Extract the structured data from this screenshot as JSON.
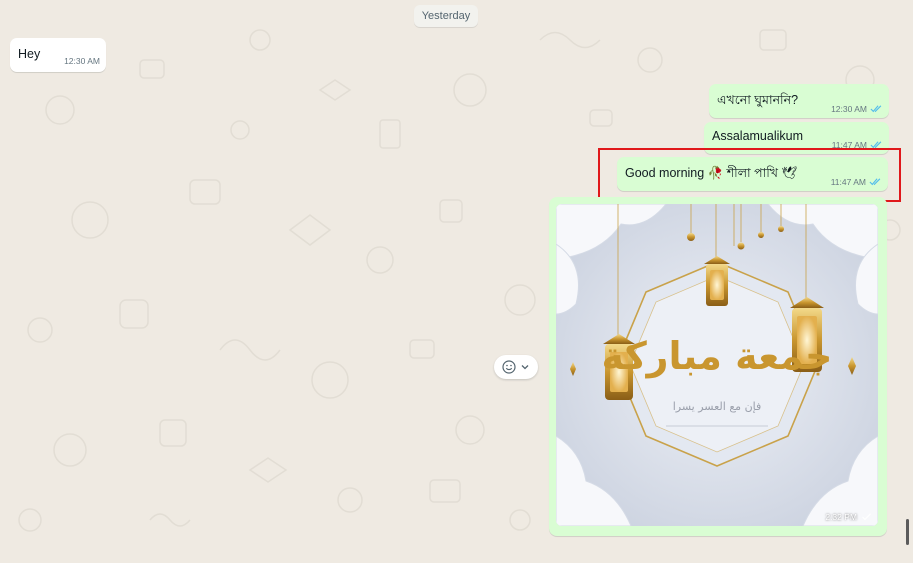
{
  "chat": {
    "date_divider": "Yesterday",
    "messages": [
      {
        "direction": "in",
        "text": "Hey",
        "time": "12:30 AM"
      },
      {
        "direction": "out",
        "text": "এখনো ঘুমাননি?",
        "time": "12:30 AM",
        "status": "read"
      },
      {
        "direction": "out",
        "text": "Assalamualikum",
        "time": "11:47 AM",
        "status": "read"
      },
      {
        "direction": "out",
        "text": "Good morning 🥀 শীলা পাখি 🕊",
        "time": "11:47 AM",
        "status": "read",
        "highlighted": true
      },
      {
        "direction": "out",
        "type": "image",
        "image_text": "جمعة مباركة",
        "image_subtext": "فإن مع العسر يسرا",
        "time": "2:32 PM",
        "status": "sent"
      }
    ]
  },
  "reaction_button": {
    "icon": "smiley-icon",
    "chevron": "chevron-down-icon"
  },
  "colors": {
    "chat_bg": "#efeae2",
    "incoming": "#ffffff",
    "outgoing": "#d9fdd3",
    "read_tick": "#53bdeb",
    "highlight": "#e0181b"
  }
}
